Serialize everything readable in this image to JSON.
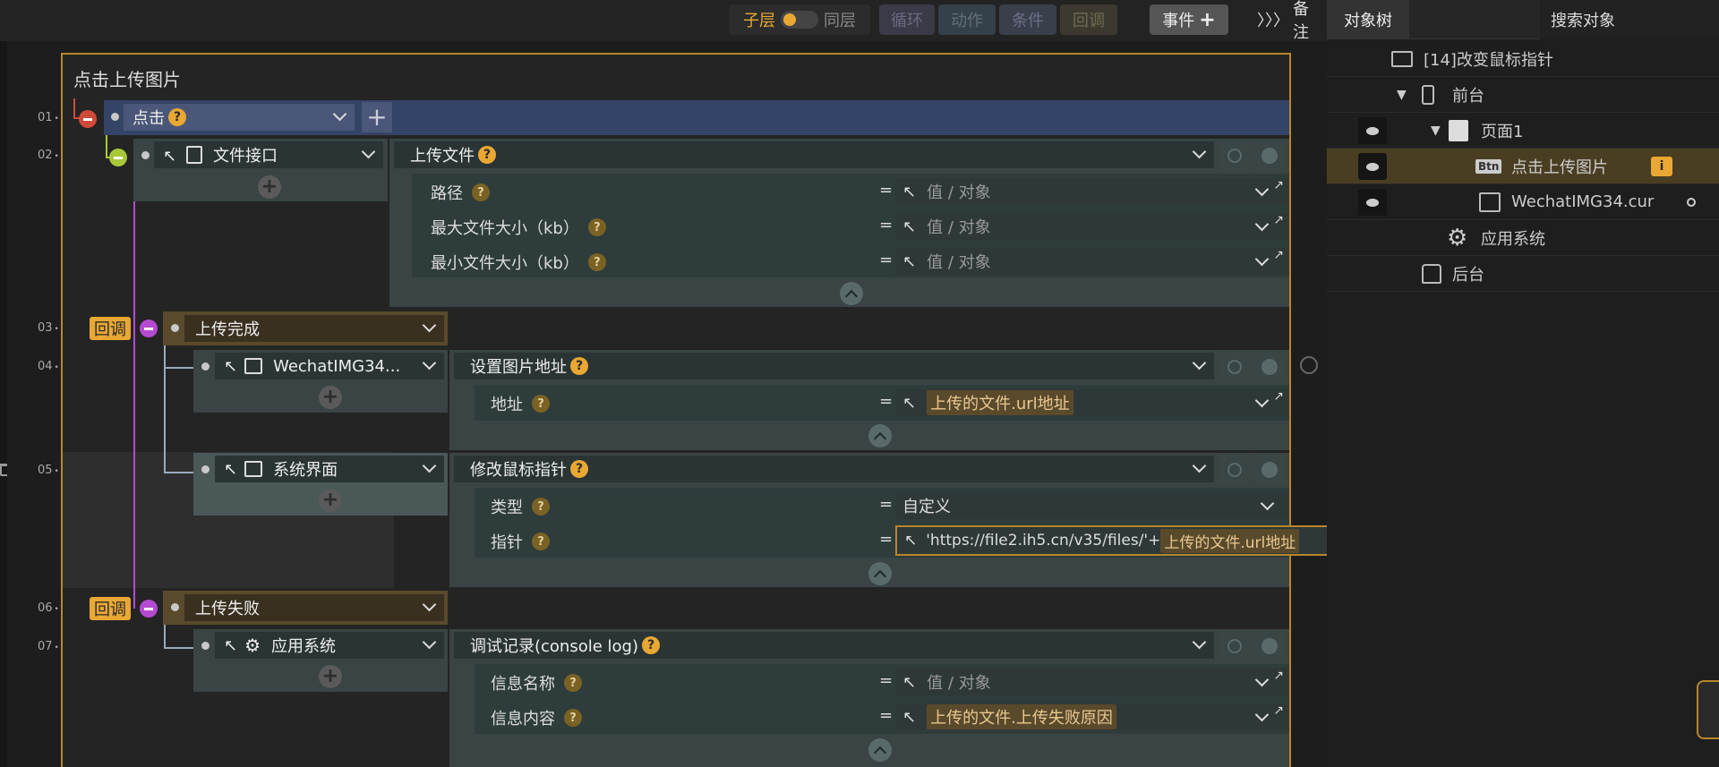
{
  "toolbar": {
    "child_label": "子层",
    "sibling_label": "同层",
    "loop": "循环",
    "action": "动作",
    "condition": "条件",
    "callback": "回调",
    "event": "事件",
    "notes": "备注"
  },
  "panel": {
    "tab_tree": "对象树",
    "tab_search": "搜索对象",
    "tree": [
      {
        "label": "[14]改变鼠标指针",
        "icon": "event-icon"
      },
      {
        "label": "前台",
        "icon": "phone-icon"
      },
      {
        "label": "页面1",
        "icon": "page-icon"
      },
      {
        "label": "点击上传图片",
        "icon": "btn-icon",
        "badge": "Btn"
      },
      {
        "label": "WechatIMG34.cur",
        "icon": "image-icon"
      },
      {
        "label": "应用系统",
        "icon": "gear-icon"
      },
      {
        "label": "后台",
        "icon": "backend-icon"
      }
    ]
  },
  "block": {
    "title": "点击上传图片",
    "rows": [
      "01",
      "02",
      "03",
      "04",
      "05",
      "06",
      "07"
    ],
    "trigger": "点击",
    "callback_label": "回调",
    "value_placeholder": "值 / 对象",
    "r2": {
      "target": "文件接口",
      "action": "上传文件",
      "params": [
        "路径",
        "最大文件大小（kb）",
        "最小文件大小（kb）"
      ]
    },
    "r3": {
      "event": "上传完成"
    },
    "r4": {
      "target": "WechatIMG34...",
      "action": "设置图片地址",
      "param": "地址",
      "value": "上传的文件.url地址"
    },
    "r5": {
      "target": "系统界面",
      "action": "修改鼠标指针",
      "param_type": "类型",
      "type_value": "自定义",
      "param_ptr": "指针",
      "ptr_prefix": "'https://file2.ih5.cn/v35/files/'+",
      "ptr_tag": "上传的文件.url地址"
    },
    "r6": {
      "event": "上传失败"
    },
    "r7": {
      "target": "应用系统",
      "action": "调试记录(console log)",
      "param_name": "信息名称",
      "param_content": "信息内容",
      "content_value": "上传的文件.上传失败原因"
    }
  },
  "eq": "=",
  "colors": {
    "accent": "#e8a833",
    "callback_line": "#b44bd0",
    "trigger_row": "#344466"
  }
}
